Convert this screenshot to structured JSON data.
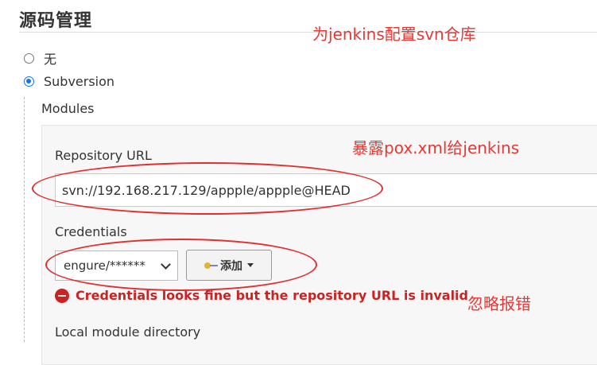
{
  "section": {
    "title": "源码管理"
  },
  "scm_options": [
    {
      "label": "无",
      "selected": false
    },
    {
      "label": "Subversion",
      "selected": true
    }
  ],
  "modules": {
    "label": "Modules",
    "repository_url_label": "Repository URL",
    "repository_url_value": "svn://192.168.217.129/appple/appple@HEAD",
    "credentials_label": "Credentials",
    "credentials_selected": "engure/******",
    "add_button_label": "添加",
    "error_message": "Credentials looks fine but the repository URL is invalid",
    "local_dir_label": "Local module directory"
  },
  "annotations": {
    "top": "为jenkins配置svn仓库",
    "middle": "暴露pox.xml给jenkins",
    "bottom": "忽略报错"
  },
  "colors": {
    "annotation_red": "#e53935",
    "error_red": "#cc2222",
    "radio_blue": "#1a73e8"
  }
}
